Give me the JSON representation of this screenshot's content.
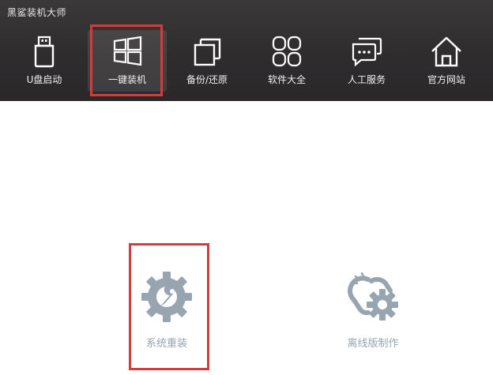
{
  "app": {
    "title": "黑鲨装机大师"
  },
  "nav": {
    "items": [
      {
        "label": "U盘启动",
        "icon": "usb-drive-icon"
      },
      {
        "label": "一键装机",
        "icon": "windows-icon"
      },
      {
        "label": "备份/还原",
        "icon": "copy-icon"
      },
      {
        "label": "软件大全",
        "icon": "apps-grid-icon"
      },
      {
        "label": "人工服务",
        "icon": "chat-bubbles-icon"
      },
      {
        "label": "官方网站",
        "icon": "home-icon"
      }
    ],
    "active_index": 1
  },
  "main": {
    "cards": [
      {
        "label": "系统重装",
        "icon": "gear-wrench-icon"
      },
      {
        "label": "离线版制作",
        "icon": "gear-link-icon"
      }
    ]
  },
  "colors": {
    "topbar": "#2e2c2d",
    "highlight": "#d23c3c",
    "card_icon": "#97a5b0"
  }
}
